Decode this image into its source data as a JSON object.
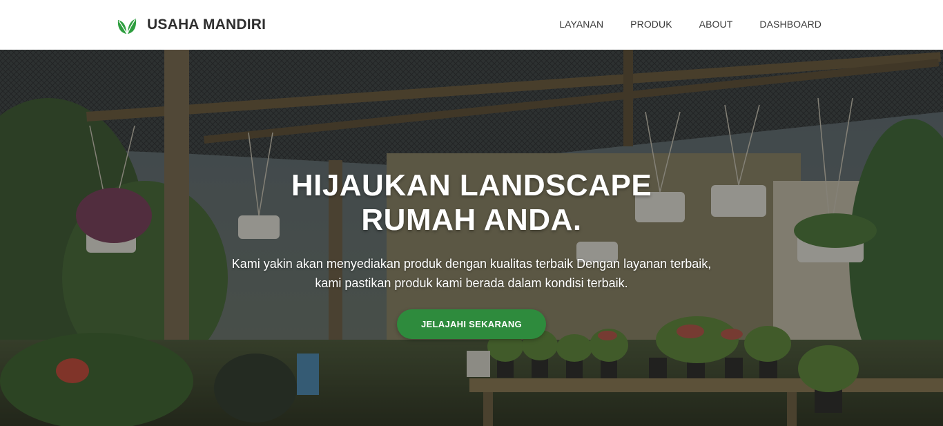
{
  "brand": {
    "name": "USAHA MANDIRI",
    "icon": "leaf-icon",
    "color": "#2e9e3f"
  },
  "nav": {
    "items": [
      {
        "label": "LAYANAN"
      },
      {
        "label": "PRODUK"
      },
      {
        "label": "ABOUT"
      },
      {
        "label": "DASHBOARD"
      }
    ]
  },
  "hero": {
    "title_line1": "HIJAUKAN LANDSCAPE",
    "title_line2": "RUMAH ANDA.",
    "description": "Kami yakin akan menyediakan produk dengan kualitas terbaik Dengan layanan terbaik, kami pastikan produk kami berada dalam kondisi terbaik.",
    "cta_label": "JELAJAHI SEKARANG",
    "cta_color": "#2e8b3d",
    "background": "greenhouse-nursery-photo"
  }
}
